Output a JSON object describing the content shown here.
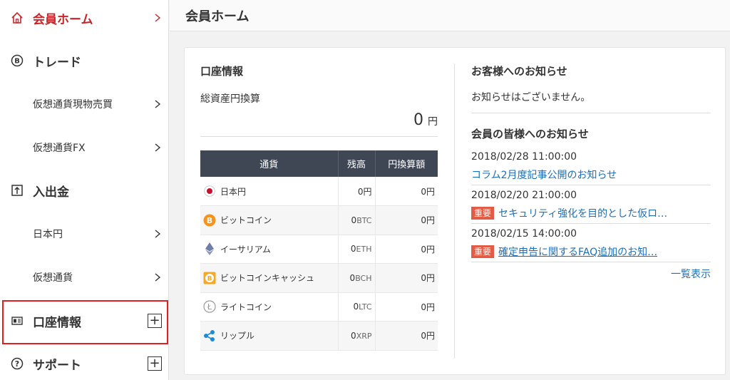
{
  "sidebar": {
    "items": [
      {
        "label": "会員ホーム",
        "icon": "home-icon",
        "type": "top",
        "active": true,
        "control": "chevron"
      },
      {
        "label": "トレード",
        "icon": "bitcoin-icon",
        "type": "top",
        "control": "none"
      },
      {
        "label": "仮想通貨現物売買",
        "type": "sub",
        "control": "chevron"
      },
      {
        "label": "仮想通貨FX",
        "type": "sub",
        "control": "chevron"
      },
      {
        "label": "入出金",
        "icon": "deposit-icon",
        "type": "top",
        "control": "none"
      },
      {
        "label": "日本円",
        "type": "sub",
        "control": "chevron"
      },
      {
        "label": "仮想通貨",
        "type": "sub",
        "control": "chevron"
      },
      {
        "label": "口座情報",
        "icon": "id-card-icon",
        "type": "top",
        "control": "plus"
      },
      {
        "label": "サポート",
        "icon": "help-icon",
        "type": "top",
        "control": "plus"
      }
    ],
    "plus_symbol": "+"
  },
  "header": {
    "title": "会員ホーム"
  },
  "account": {
    "title": "口座情報",
    "total_label": "総資産円換算",
    "total_value": "0",
    "total_unit": "円",
    "columns": [
      "通貨",
      "残高",
      "円換算額"
    ],
    "rows": [
      {
        "name": "日本円",
        "icon": "japan-flag-icon",
        "balance": "0",
        "balance_unit": "円",
        "jpy": "0円"
      },
      {
        "name": "ビットコイン",
        "icon": "bitcoin-coin-icon",
        "balance": "0",
        "balance_unit": "BTC",
        "jpy": "0円"
      },
      {
        "name": "イーサリアム",
        "icon": "ethereum-icon",
        "balance": "0",
        "balance_unit": "ETH",
        "jpy": "0円"
      },
      {
        "name": "ビットコインキャッシュ",
        "icon": "bitcoin-cash-icon",
        "balance": "0",
        "balance_unit": "BCH",
        "jpy": "0円"
      },
      {
        "name": "ライトコイン",
        "icon": "litecoin-icon",
        "balance": "0",
        "balance_unit": "LTC",
        "jpy": "0円"
      },
      {
        "name": "リップル",
        "icon": "ripple-icon",
        "balance": "0",
        "balance_unit": "XRP",
        "jpy": "0円"
      }
    ]
  },
  "notices": {
    "customer_title": "お客様へのお知らせ",
    "customer_empty": "お知らせはございません。",
    "member_title": "会員の皆様へのお知らせ",
    "items": [
      {
        "date": "2018/02/28 11:00:00",
        "badge": "",
        "text": "コラム2月度記事公開のお知らせ"
      },
      {
        "date": "2018/02/20 21:00:00",
        "badge": "重要",
        "text": "セキュリティ強化を目的とした仮ロ…"
      },
      {
        "date": "2018/02/15 14:00:00",
        "badge": "重要",
        "text": "確定申告に関するFAQ追加のお知…"
      }
    ],
    "view_all": "一覧表示"
  },
  "colors": {
    "accent": "#c8262a",
    "table_header": "#3f4654",
    "link": "#1d6fb8",
    "badge": "#e25b45",
    "highlight_box": "#e02020"
  }
}
